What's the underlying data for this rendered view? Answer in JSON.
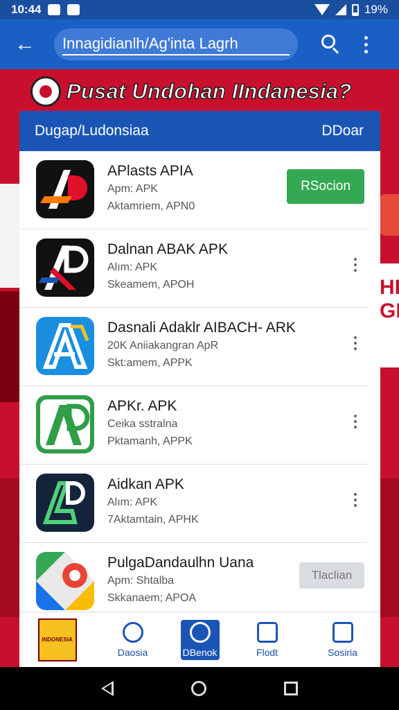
{
  "status_bar": {
    "time": "10:44",
    "battery": "19%"
  },
  "app_bar": {
    "search_value": "Innagidianlh/Ag'inta Lagrh"
  },
  "banner": {
    "title": "Pusat Undohan IIndanesia?"
  },
  "side_text": {
    "right": "HI GE"
  },
  "card": {
    "header_left": "Dugap/Ludonsiaa",
    "header_right": "DDoar",
    "apps": [
      {
        "name": "APlasts APIA",
        "sub": "Apm: APK",
        "meta": "Aktamriem, APN0",
        "action": "install",
        "action_label": "RSocion",
        "icon": "ap-red"
      },
      {
        "name": "Dalnan ABAK APK",
        "sub": "Alım: APK",
        "meta": "Skeamem, APOH",
        "action": "menu",
        "icon": "ap-white"
      },
      {
        "name": "Dasnali Adaklr AIBACH- ARK",
        "sub": "20K Aniiakangran ApR",
        "meta": "Skt:amem, APPK",
        "action": "menu",
        "icon": "ap-blue"
      },
      {
        "name": "APKr. APK",
        "sub": "Ceika sstralna",
        "meta": "Pktamanh, APPK",
        "action": "menu",
        "icon": "ap-green"
      },
      {
        "name": "Aidkan APK",
        "sub": "Alım: APK",
        "meta": "7Aktamtain, APHK",
        "action": "menu",
        "icon": "ap-navy"
      },
      {
        "name": "PulgaDandaulhn Uana",
        "sub": "Apm: Shtalba",
        "meta": "Skkanaem; APOA",
        "action": "install_disabled",
        "action_label": "Tlaclian",
        "icon": "maps"
      }
    ]
  },
  "bottom_nav": [
    {
      "label": "",
      "type": "thumb",
      "thumb_text": "INDONESIA"
    },
    {
      "label": "Daosia",
      "type": "icon"
    },
    {
      "label": "DBenok",
      "type": "icon",
      "active": true
    },
    {
      "label": "Flodt",
      "type": "icon"
    },
    {
      "label": "Sosiria",
      "type": "icon"
    }
  ],
  "colors": {
    "primary": "#1a55b5",
    "app_bar": "#1a5fc4",
    "install": "#34a853",
    "banner_red": "#c8102e"
  }
}
